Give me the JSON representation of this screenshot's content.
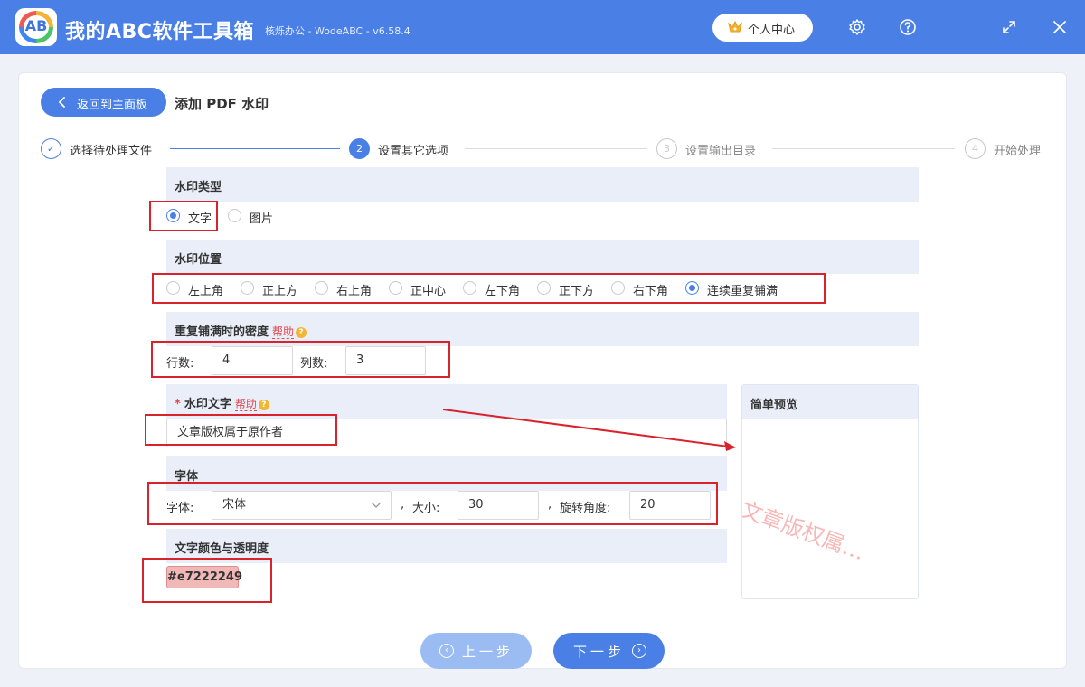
{
  "app": {
    "title": "我的ABC软件工具箱",
    "subtitle": "核烁办公 - WodeABC - v6.58.4",
    "logo_text": "AB",
    "user_center": "个人中心"
  },
  "window_controls": [
    "settings-icon",
    "help-icon",
    "maximize-icon",
    "close-icon"
  ],
  "header": {
    "back_label": "返回到主面板",
    "page_title": "添加 PDF 水印"
  },
  "steps": [
    {
      "num": "✓",
      "label": "选择待处理文件",
      "state": "done"
    },
    {
      "num": "2",
      "label": "设置其它选项",
      "state": "active"
    },
    {
      "num": "3",
      "label": "设置输出目录",
      "state": "todo"
    },
    {
      "num": "4",
      "label": "开始处理",
      "state": "todo"
    }
  ],
  "watermark_type": {
    "title": "水印类型",
    "options": [
      "文字",
      "图片"
    ],
    "selected": "文字"
  },
  "watermark_position": {
    "title": "水印位置",
    "options": [
      "左上角",
      "正上方",
      "右上角",
      "正中心",
      "左下角",
      "正下方",
      "右下角",
      "连续重复铺满"
    ],
    "selected": "连续重复铺满"
  },
  "density": {
    "title": "重复铺满时的密度",
    "help": "帮助",
    "rows_label": "行数:",
    "rows_value": "4",
    "cols_label": "列数:",
    "cols_value": "3"
  },
  "watermark_text": {
    "required_mark": "*",
    "title": "水印文字",
    "help": "帮助",
    "value": "文章版权属于原作者"
  },
  "font": {
    "title": "字体",
    "font_label": "字体:",
    "font_value": "宋体",
    "sep1": ",",
    "size_label": "大小:",
    "size_value": "30",
    "sep2": ",",
    "rotate_label": "旋转角度:",
    "rotate_value": "20"
  },
  "color": {
    "title": "文字颜色与透明度",
    "value": "#e7222249"
  },
  "preview": {
    "title": "简单预览",
    "sample": "文章版权属…"
  },
  "nav": {
    "prev": "上一步",
    "next": "下一步"
  },
  "colors": {
    "primary": "#4a7fe5",
    "highlight": "#d9232c",
    "watermark": "#e72222"
  }
}
